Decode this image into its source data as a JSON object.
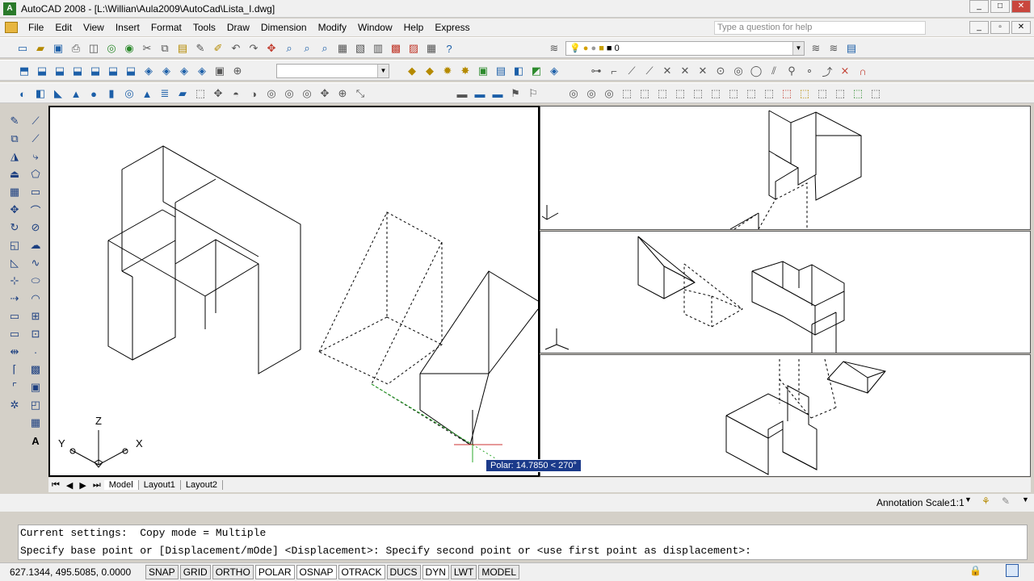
{
  "window": {
    "title": "AutoCAD 2008 - [L:\\Willian\\Aula2009\\AutoCad\\Lista_I.dwg]"
  },
  "menubar": {
    "items": [
      "File",
      "Edit",
      "View",
      "Insert",
      "Format",
      "Tools",
      "Draw",
      "Dimension",
      "Modify",
      "Window",
      "Help",
      "Express"
    ],
    "help_placeholder": "Type a question for help"
  },
  "layer": {
    "current": "0"
  },
  "tabs": [
    "Model",
    "Layout1",
    "Layout2"
  ],
  "annotation": {
    "label": "Annotation Scale:",
    "value": "1:1"
  },
  "command": {
    "line1": "Current settings:  Copy mode = Multiple",
    "line2": "Specify base point or [Displacement/mOde] <Displacement>: Specify second point or <use first point as displacement>:"
  },
  "status": {
    "coords": "627.1344, 495.5085, 0.0000",
    "buttons": [
      "SNAP",
      "GRID",
      "ORTHO",
      "POLAR",
      "OSNAP",
      "OTRACK",
      "DUCS",
      "DYN",
      "LWT",
      "MODEL"
    ]
  },
  "tooltip": {
    "polar": "Polar: 14.7850 < 270°"
  },
  "ucs": {
    "x": "X",
    "y": "Y",
    "z": "Z"
  }
}
